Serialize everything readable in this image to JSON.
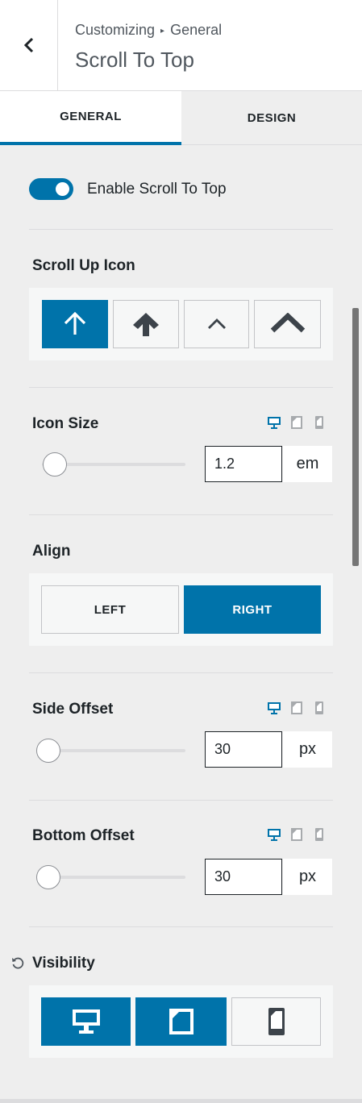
{
  "header": {
    "breadcrumb_parent": "Customizing",
    "breadcrumb_separator": "▸",
    "breadcrumb_current": "General",
    "title": "Scroll To Top"
  },
  "tabs": [
    {
      "label": "GENERAL",
      "active": true
    },
    {
      "label": "DESIGN",
      "active": false
    }
  ],
  "enable_toggle": {
    "label": "Enable Scroll To Top",
    "on": true
  },
  "scroll_up_icon": {
    "label": "Scroll Up Icon",
    "options": [
      "arrow-up-thin-icon",
      "arrow-up-bold-icon",
      "chevron-up-thin-icon",
      "chevron-up-bold-icon"
    ],
    "selected_index": 0
  },
  "icon_size": {
    "label": "Icon Size",
    "value": "1.2",
    "unit": "em",
    "slider_level": 0.08
  },
  "align": {
    "label": "Align",
    "options": [
      "LEFT",
      "RIGHT"
    ],
    "selected": "RIGHT"
  },
  "side_offset": {
    "label": "Side Offset",
    "value": "30",
    "unit": "px",
    "slider_level": 0.0
  },
  "bottom_offset": {
    "label": "Bottom Offset",
    "value": "30",
    "unit": "px",
    "slider_level": 0.0
  },
  "visibility": {
    "label": "Visibility",
    "options": [
      {
        "icon": "desktop-icon",
        "active": true
      },
      {
        "icon": "tablet-icon",
        "active": true
      },
      {
        "icon": "mobile-icon",
        "active": false
      }
    ]
  },
  "colors": {
    "accent": "#0073aa",
    "panel": "#f6f7f7",
    "background": "#eeeeee",
    "icon_dark": "#3c434a"
  }
}
